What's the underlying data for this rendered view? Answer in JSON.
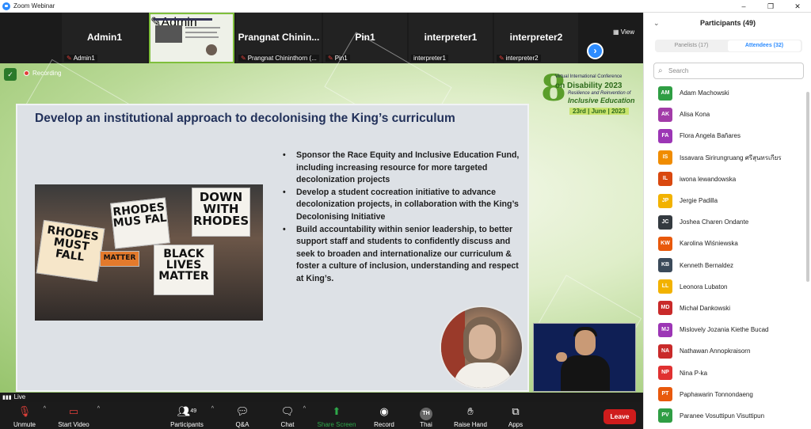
{
  "window": {
    "title": "Zoom Webinar",
    "controls": [
      "–",
      "❐",
      "✕"
    ]
  },
  "strip": {
    "tiles": [
      {
        "name": "Admin1",
        "label": "Admin1"
      },
      {
        "name": "",
        "label": "Admin"
      },
      {
        "name": "Prangnat Chinin...",
        "label": "Prangnat Chininthorn (..."
      },
      {
        "name": "Pin1",
        "label": "Pin1"
      },
      {
        "name": "interpreter1",
        "label": "interpreter1"
      },
      {
        "name": "interpreter2",
        "label": "interpreter2"
      }
    ],
    "view_label": "View",
    "next_icon": "chevron-right-icon"
  },
  "meeting": {
    "recording_label": "Recording",
    "live_label": "Live"
  },
  "conference": {
    "line1": "Virtual International Conference",
    "line2": "on Disability 2023",
    "line3": "Resilience and Reinvention of",
    "line4": "Inclusive Education",
    "date": "23rd | June | 2023",
    "number": "8",
    "sup": "th"
  },
  "slide": {
    "title": "Develop an institutional approach to decolonising the King’s curriculum",
    "bullets": [
      "Sponsor the Race Equity and Inclusive Education Fund, including increasing resource for more targeted decolonization projects",
      "Develop a student cocreation initiative to advance decolonization projects, in collaboration with the King’s Decolonising Initiative",
      "Build accountability within senior leadership, to better support staff and students to confidently discuss and seek to broaden and internationalize our curriculum & foster a culture of inclusion, understanding and respect at King’s."
    ],
    "photo_signs": [
      "DOWN WITH RHODES",
      "RHODES MUS FAL",
      "RHODES MUST FALL",
      "BLACK LIVES MATTER",
      "MATTER"
    ]
  },
  "toolbar": {
    "unmute": "Unmute",
    "start_video": "Start Video",
    "participants": "Participants",
    "participants_count": "49",
    "qa": "Q&A",
    "chat": "Chat",
    "share_screen": "Share Screen",
    "record": "Record",
    "thai": "Thai",
    "thai_badge": "TH",
    "raise_hand": "Raise Hand",
    "apps": "Apps",
    "leave": "Leave"
  },
  "participants_panel": {
    "title": "Participants (49)",
    "tab_panelists": "Panelists (17)",
    "tab_attendees": "Attendees (32)",
    "search_placeholder": "Search",
    "attendees": [
      {
        "initials": "AM",
        "name": "Adam Machowski",
        "color": "#2f9e44"
      },
      {
        "initials": "AK",
        "name": "Alisa Kona",
        "color": "#a23ca8"
      },
      {
        "initials": "FA",
        "name": "Flora Angela Bañares",
        "color": "#9c36b5"
      },
      {
        "initials": "IS",
        "name": "Issavara Sirirungruang ศรีสุนทรเกียร",
        "color": "#f08c00"
      },
      {
        "initials": "IL",
        "name": "iwona lewandowska",
        "color": "#d9480f"
      },
      {
        "initials": "JP",
        "name": "Jergie Padilla",
        "color": "#f2b200"
      },
      {
        "initials": "JC",
        "name": "Joshea Charen Ondante",
        "color": "#343a40"
      },
      {
        "initials": "KW",
        "name": "Karolina Wiśniewska",
        "color": "#e8590c"
      },
      {
        "initials": "KB",
        "name": "Kenneth Bernaldez",
        "color": "#3b4a5a"
      },
      {
        "initials": "LL",
        "name": "Leonora Lubaton",
        "color": "#f2b200"
      },
      {
        "initials": "MD",
        "name": "Michał Dankowski",
        "color": "#c92a2a"
      },
      {
        "initials": "MJ",
        "name": "Mislovely Jozania Kiethe Bucad",
        "color": "#9c36b5"
      },
      {
        "initials": "NA",
        "name": "Nathawan Annopkraisorn",
        "color": "#c92a2a"
      },
      {
        "initials": "NP",
        "name": "Nina P-ka",
        "color": "#e03131"
      },
      {
        "initials": "PT",
        "name": "Paphawarin Tonnondaeng",
        "color": "#e8590c"
      },
      {
        "initials": "PV",
        "name": "Paranee Vosuttipun Visuttipun",
        "color": "#2f9e44"
      }
    ]
  }
}
